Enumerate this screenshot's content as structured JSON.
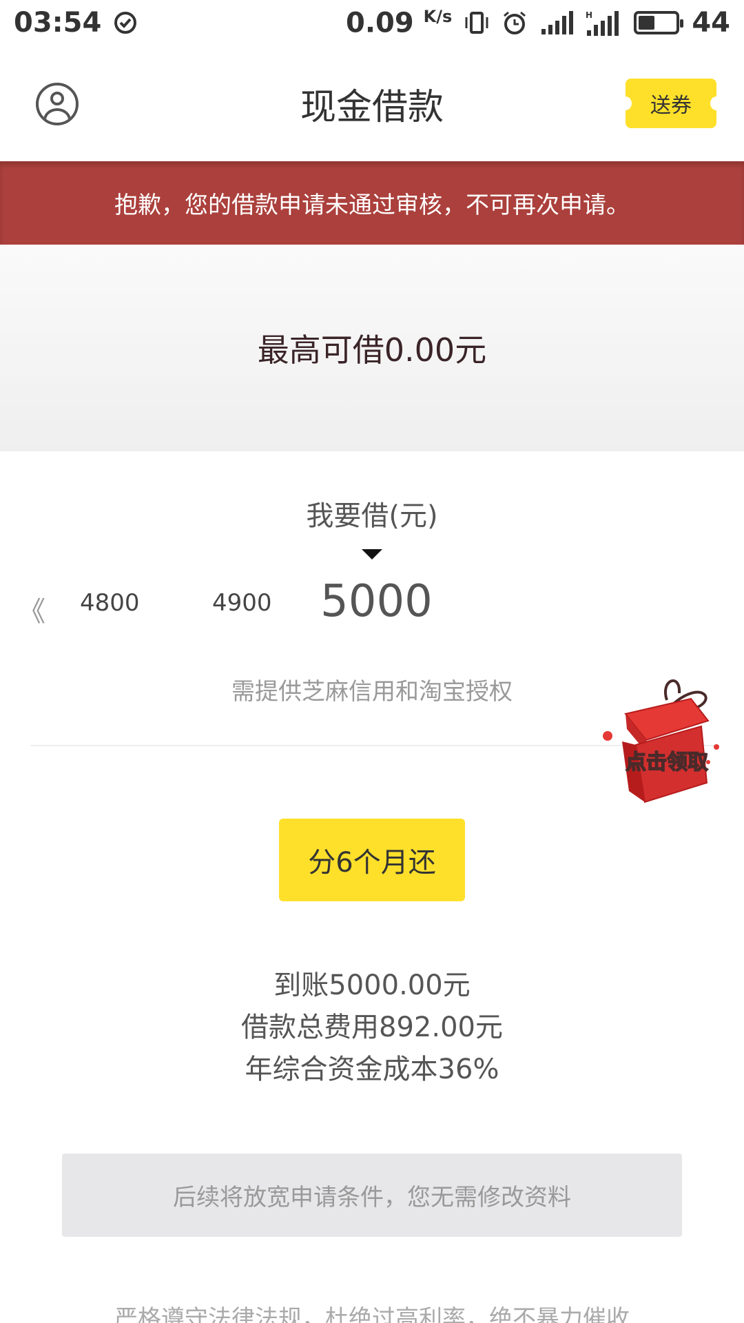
{
  "status_bar": {
    "time": "03:54",
    "net_speed": "0.09",
    "net_speed_unit": "K/s",
    "battery_level": "44"
  },
  "header": {
    "title": "现金借款",
    "coupon_label": "送券"
  },
  "alert": {
    "message": "抱歉，您的借款申请未通过审核，不可再次申请。"
  },
  "limit": {
    "text": "最高可借0.00元"
  },
  "picker": {
    "label": "我要借(元)",
    "left_glyph": "《",
    "amounts": [
      "4800",
      "4900"
    ],
    "selected_amount": "5000",
    "hint": "需提供芝麻信用和淘宝授权"
  },
  "gift": {
    "text": "点击领取"
  },
  "installment": {
    "label": "分6个月还"
  },
  "summary": {
    "received": "到账5000.00元",
    "total_fee": "借款总费用892.00元",
    "annual_rate": "年综合资金成本36%"
  },
  "notice": {
    "text": "后续将放宽申请条件，您无需修改资料"
  },
  "footer": {
    "text": "严格遵守法律法规，杜绝过高利率，绝不暴力催收"
  },
  "colors": {
    "banner_red": "#ab403c",
    "accent_yellow": "#fee02a",
    "notice_gray": "#e7e7ea"
  }
}
